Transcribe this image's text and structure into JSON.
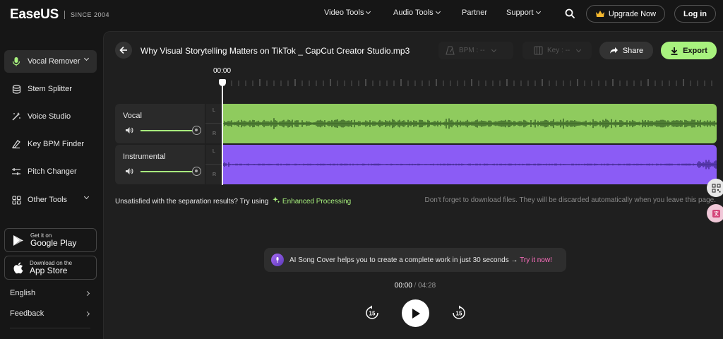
{
  "brand": {
    "name": "EaseUS",
    "tagline": "SINCE 2004"
  },
  "nav": {
    "links": [
      {
        "label": "Video Tools",
        "dropdown": true
      },
      {
        "label": "Audio Tools",
        "dropdown": true
      },
      {
        "label": "Partner",
        "dropdown": false
      },
      {
        "label": "Support",
        "dropdown": true
      }
    ],
    "upgrade_label": "Upgrade Now",
    "login_label": "Log in"
  },
  "sidebar": {
    "items": [
      {
        "label": "Vocal Remover",
        "icon": "microphone-icon",
        "active": true
      },
      {
        "label": "Stem Splitter",
        "icon": "stack-icon"
      },
      {
        "label": "Voice Studio",
        "icon": "sparkle-wand-icon"
      },
      {
        "label": "Key BPM Finder",
        "icon": "music-key-icon"
      },
      {
        "label": "Pitch Changer",
        "icon": "sliders-icon"
      },
      {
        "label": "Other Tools",
        "icon": "grid-icon"
      }
    ],
    "google_play": {
      "small": "Get it on",
      "big": "Google Play"
    },
    "app_store": {
      "small": "Download on the",
      "big": "App Store"
    },
    "language_label": "English",
    "feedback_label": "Feedback"
  },
  "editor": {
    "file_title": "Why Visual Storytelling Matters on TikTok _ CapCut Creator Studio.mp3",
    "bpm_label": "BPM : --",
    "key_label": "Key : --",
    "share_label": "Share",
    "export_label": "Export",
    "time_marker": "00:00",
    "tracks": [
      {
        "name": "Vocal",
        "color": "#8fcb5e",
        "wave_color": "#3f6a2a",
        "volume": 1.0
      },
      {
        "name": "Instrumental",
        "color": "#8b5cf5",
        "wave_color": "#4a2f9a",
        "volume": 1.0
      }
    ],
    "channel_left": "L",
    "channel_right": "R",
    "unsatisfied_text": "Unsatisfied with the separation results? Try using",
    "enhanced_label": "Enhanced Processing",
    "discard_note": "Don't forget to download files. They will be discarded automatically when you leave this page."
  },
  "promo": {
    "text": "AI Song Cover helps you to create a complete work in just 30 seconds →",
    "cta": "Try it now!"
  },
  "player": {
    "current": "00:00",
    "separator": "/",
    "total": "04:28",
    "skip_back_label": "15",
    "skip_forward_label": "15"
  },
  "colors": {
    "accent": "#a8f27e",
    "promo_link": "#ff6fc0"
  }
}
